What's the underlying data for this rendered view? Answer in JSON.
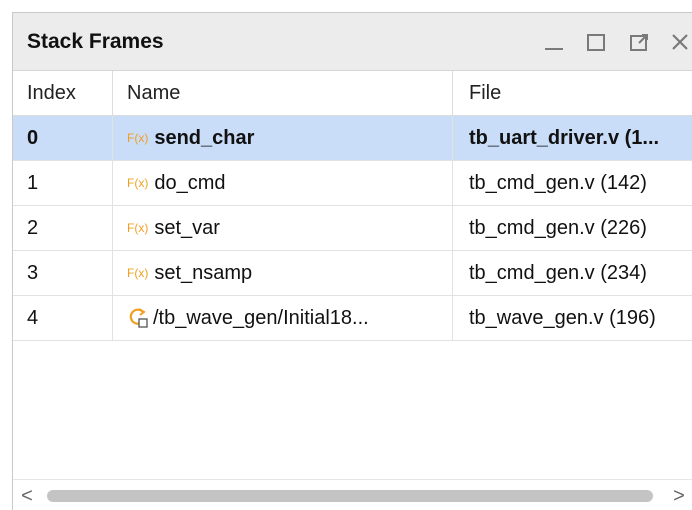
{
  "panel": {
    "title": "Stack Frames",
    "controls": {
      "minimize_icon": "minimize-icon",
      "maximize_icon": "maximize-icon",
      "restore_icon": "float-icon",
      "close_icon": "close-icon"
    }
  },
  "table": {
    "columns": {
      "index": "Index",
      "name": "Name",
      "file": "File"
    },
    "rows": [
      {
        "index": "0",
        "icon": "function-icon",
        "icon_text": "F(x)",
        "name": "send_char",
        "file": "tb_uart_driver.v (1...",
        "selected": true
      },
      {
        "index": "1",
        "icon": "function-icon",
        "icon_text": "F(x)",
        "name": "do_cmd",
        "file": "tb_cmd_gen.v (142)",
        "selected": false
      },
      {
        "index": "2",
        "icon": "function-icon",
        "icon_text": "F(x)",
        "name": "set_var",
        "file": "tb_cmd_gen.v (226)",
        "selected": false
      },
      {
        "index": "3",
        "icon": "function-icon",
        "icon_text": "F(x)",
        "name": "set_nsamp",
        "file": "tb_cmd_gen.v (234)",
        "selected": false
      },
      {
        "index": "4",
        "icon": "initial-block-icon",
        "icon_text": "",
        "name": "/tb_wave_gen/Initial18...",
        "file": "tb_wave_gen.v (196)",
        "selected": false
      }
    ]
  },
  "scrollbar": {
    "left_arrow": "<",
    "right_arrow": ">"
  },
  "colors": {
    "selected_row": "#c9dcf8",
    "title_bar": "#ececec",
    "function_icon": "#f0a020"
  }
}
